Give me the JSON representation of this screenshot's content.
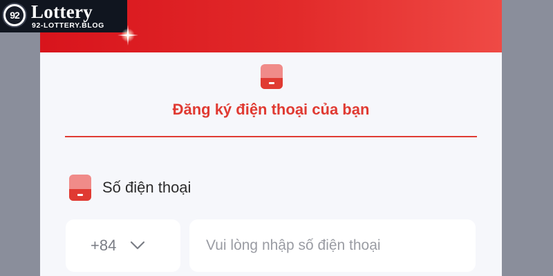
{
  "logo": {
    "badge_text": "92",
    "title": "Lottery",
    "subtitle": "92-LOTTERY.BLOG"
  },
  "icons": {
    "title_icon": "phone-icon",
    "label_icon": "phone-icon",
    "select_icon": "chevron-down-icon"
  },
  "form": {
    "section_title": "Đăng ký điện thoại của bạn",
    "phone_label": "Số điện thoại",
    "country_code": "+84",
    "phone_placeholder": "Vui lòng nhập số điện thoại",
    "phone_value": ""
  },
  "colors": {
    "brand_red": "#e03a32",
    "header_red": "#d8141c",
    "panel_bg": "#f6f7fb",
    "outer_bg": "#888c98",
    "field_bg": "#ffffff"
  }
}
